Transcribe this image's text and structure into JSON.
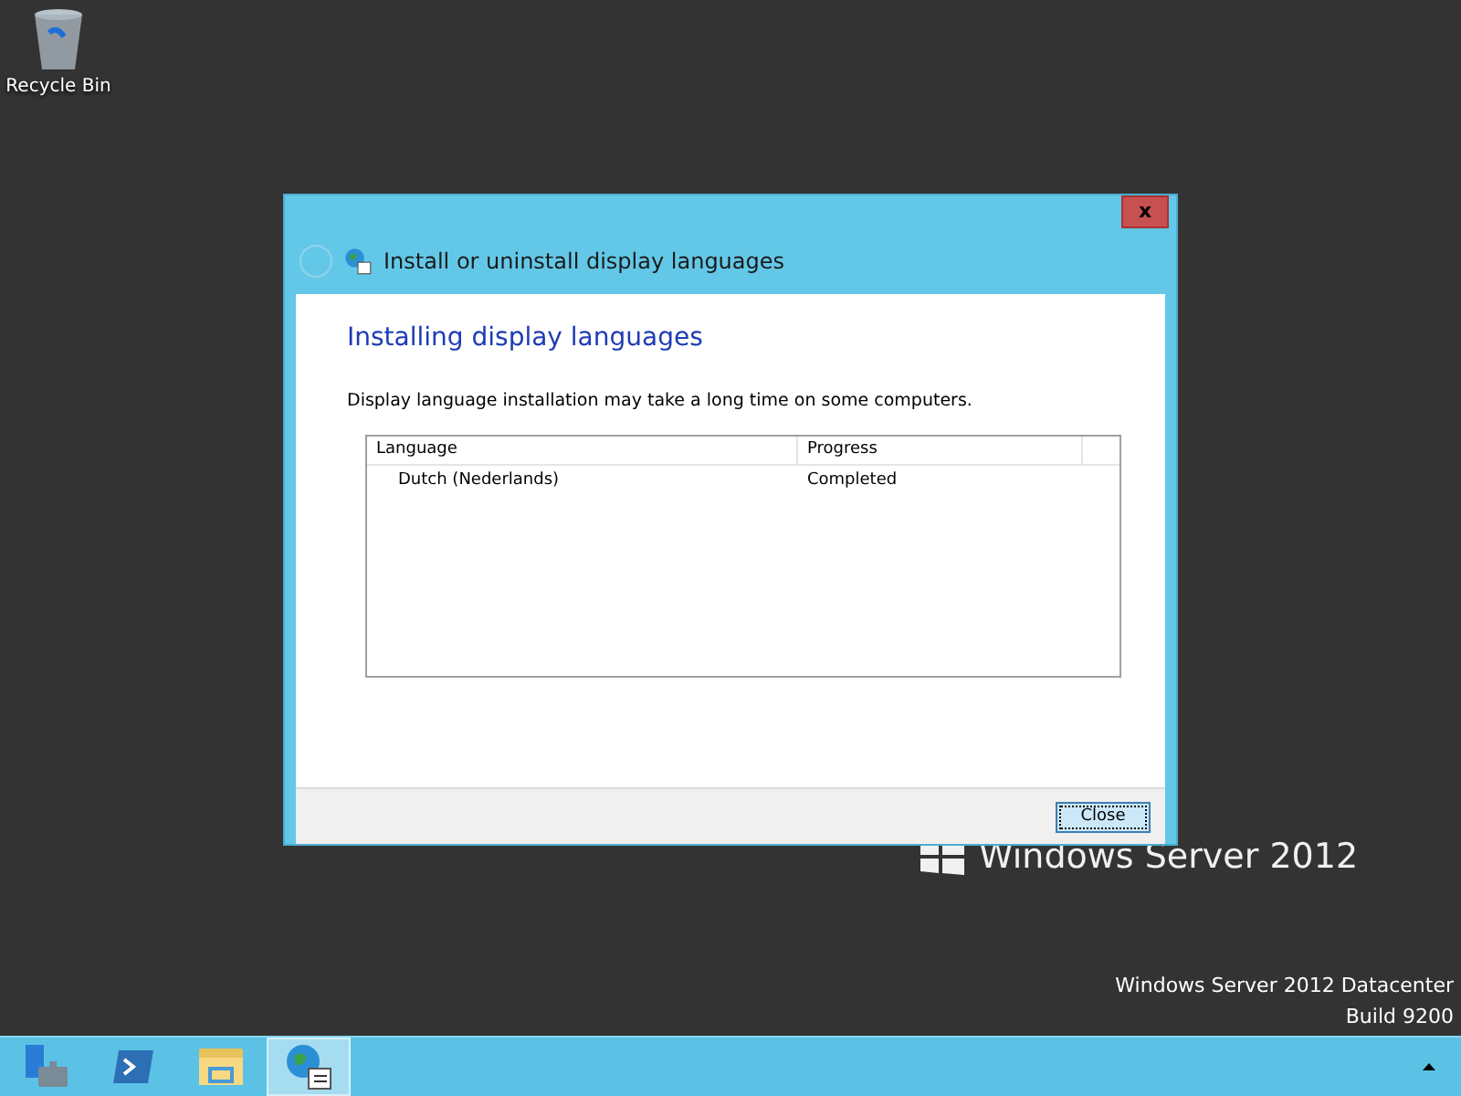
{
  "desktop_icons": [
    {
      "label": "Recycle Bin"
    }
  ],
  "window": {
    "title": "Install or uninstall display languages",
    "heading": "Installing display languages",
    "description": "Display language installation may take a long time on some computers.",
    "close_glyph": "x",
    "back_disabled": true
  },
  "table": {
    "columns": [
      "Language",
      "Progress"
    ],
    "rows": [
      {
        "language": "Dutch (Nederlands)",
        "progress": "Completed"
      }
    ]
  },
  "buttons": [
    {
      "label": "Close",
      "focused": true
    }
  ],
  "branding": {
    "logo_text": "Windows Server 2012"
  },
  "edition": [
    "Windows Server 2012 Datacenter",
    "Build 9200"
  ],
  "taskbar": {
    "items": [
      {
        "kind": "server",
        "selected": false
      },
      {
        "kind": "shell",
        "selected": false
      },
      {
        "kind": "folder",
        "selected": false
      },
      {
        "kind": "language",
        "selected": true
      }
    ]
  }
}
